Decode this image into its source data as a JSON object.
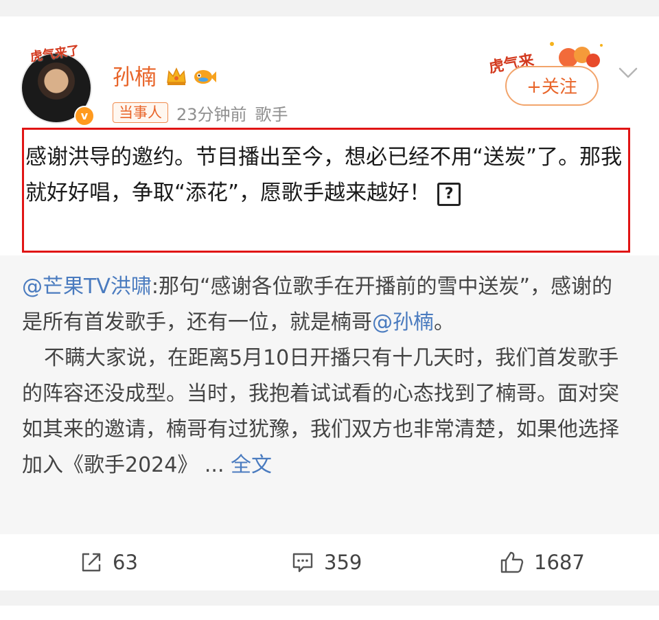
{
  "post": {
    "author": "孙楠",
    "avatar_frame_text": "虎气来了",
    "verified_mark": "v",
    "tag": "当事人",
    "time": "23分钟前",
    "identity": "歌手",
    "follow_label": "+关注",
    "decoration_text": "虎气来",
    "body": "感谢洪导的邀约。节目播出至今，想必已经不用“送炭”了。那我就好好唱，争取“添花”，愿歌手越来越好！",
    "emoji_placeholder": "?"
  },
  "repost": {
    "mention_author": "@芒果TV洪啸",
    "text_part1": ":那句“感谢各位歌手在开播前的雪中送炭”，感谢的是所有首发歌手，还有一位，就是楠哥",
    "mention_target": "@孙楠",
    "text_part2": "。",
    "paragraph2": "不瞒大家说，在距离5月10日开播只有十几天时，我们首发歌手的阵容还没成型。当时，我抱着试试看的心态找到了楠哥。面对突如其来的邀请，楠哥有过犹豫，我们双方也非常清楚，如果他选择加入《歌手2024》 ...",
    "full_text_link": "全文"
  },
  "actions": {
    "repost_count": "63",
    "comment_count": "359",
    "like_count": "1687"
  },
  "colors": {
    "accent": "#e8652a",
    "link": "#4a7bbf",
    "highlight_border": "#e01414"
  }
}
